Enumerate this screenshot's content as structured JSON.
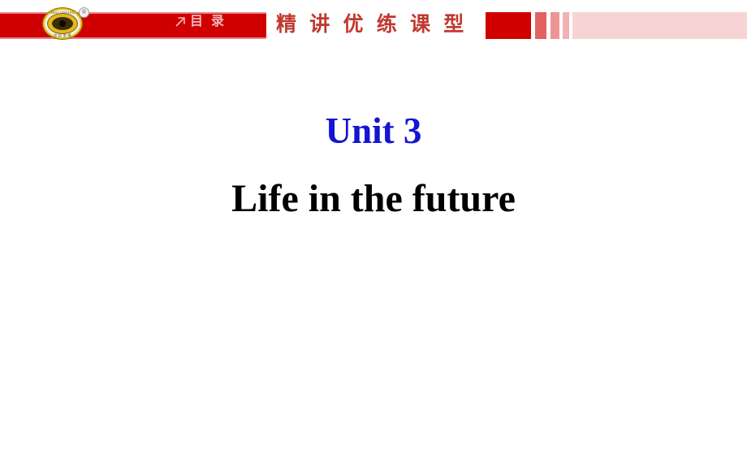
{
  "header": {
    "nav_band_color": "#d00000",
    "logo": {
      "icon": "eye-emblem-logo",
      "ring_top_text": "SHIJI JINBANG",
      "ring_bottom_text": "世 纪 金 榜",
      "registered_mark": "®"
    },
    "contents_link": {
      "icon": "arrow-up-right-icon",
      "label": "目 录"
    },
    "banner_title": "精 讲 优 练 课 型",
    "banner_title_color": "#c0392f",
    "decoration_bars": [
      {
        "name": "deco-bar-1",
        "opacity": "1.0"
      },
      {
        "name": "deco-bar-2",
        "opacity": "0.62"
      },
      {
        "name": "deco-bar-3",
        "opacity": "0.42"
      },
      {
        "name": "deco-bar-4",
        "opacity": "0.30"
      },
      {
        "name": "deco-bar-5",
        "opacity": "0.17"
      }
    ]
  },
  "slide": {
    "unit_heading": "Unit 3",
    "unit_heading_color": "#1414d2",
    "unit_subtitle": "Life in the future",
    "unit_subtitle_color": "#000000"
  }
}
